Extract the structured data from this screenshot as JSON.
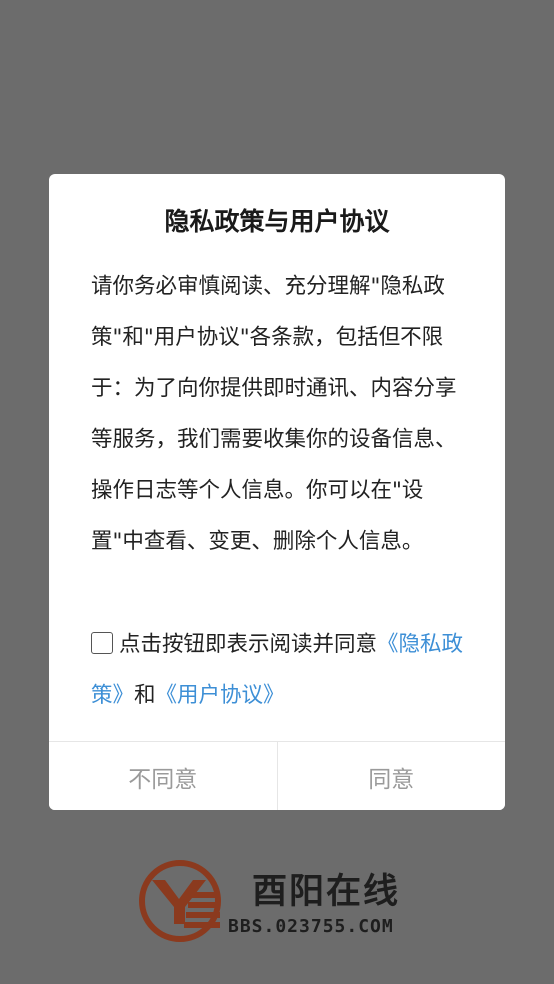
{
  "dialog": {
    "title": "隐私政策与用户协议",
    "body": "请你务必审慎阅读、充分理解\"隐私政策\"和\"用户协议\"各条款，包括但不限于：为了向你提供即时通讯、内容分享等服务，我们需要收集你的设备信息、操作日志等个人信息。你可以在\"设置\"中查看、变更、删除个人信息。",
    "consent": {
      "checked": false,
      "prefix": "点击按钮即表示阅读并同意",
      "privacy_link": "《隐私政策》",
      "conjunction": "和",
      "agreement_link": "《用户协议》"
    },
    "buttons": {
      "disagree": "不同意",
      "agree": "同意"
    }
  },
  "brand": {
    "name": "酉阳在线",
    "url": "BBS.023755.COM",
    "logo_icon": "ye-logo-icon",
    "colors": {
      "logo": "#8b3a1e",
      "link": "#3d8fd6",
      "overlay": "#6c6c6c"
    }
  }
}
